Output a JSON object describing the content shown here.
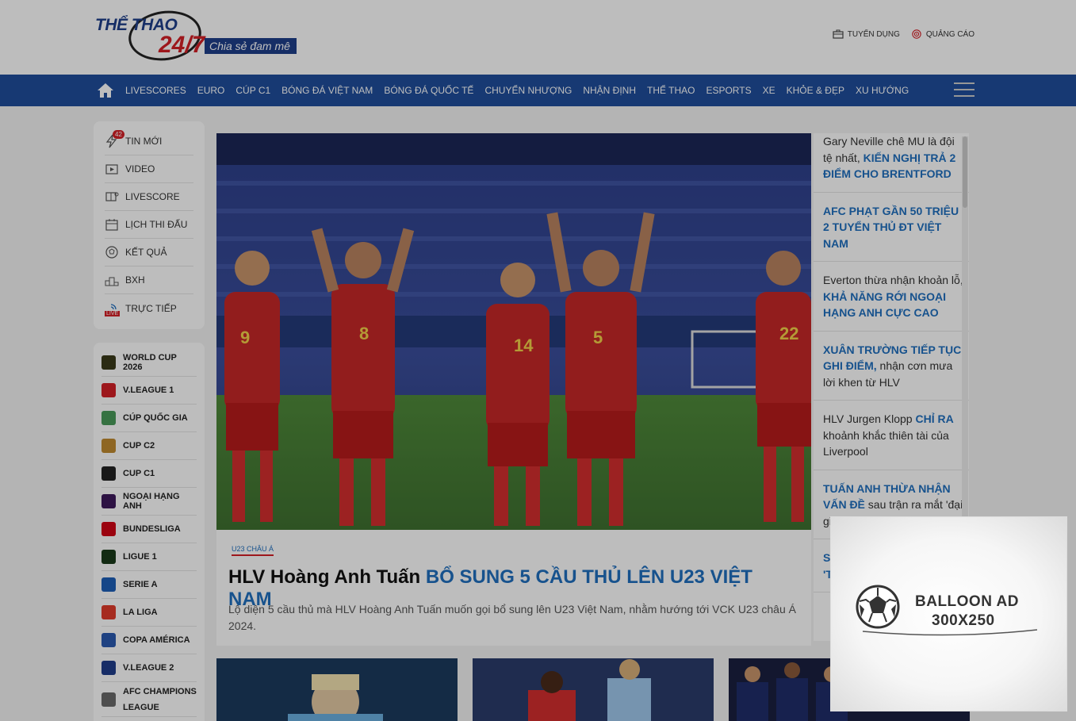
{
  "header": {
    "logo": {
      "the": "THỂ THAO",
      "num": "24/7",
      "slogan": "Chia sẻ đam mê"
    },
    "links": [
      {
        "label": "TUYỂN DỤNG",
        "icon": "briefcase-icon"
      },
      {
        "label": "QUẢNG CÁO",
        "icon": "target-icon"
      }
    ]
  },
  "nav": {
    "items": [
      "LIVESCORES",
      "EURO",
      "CÚP C1",
      "BÓNG ĐÁ VIỆT NAM",
      "BÓNG ĐÁ QUỐC TẾ",
      "CHUYỂN NHƯỢNG",
      "NHẬN ĐỊNH",
      "THỂ THAO",
      "ESPORTS",
      "XE",
      "KHỎE & ĐẸP",
      "XU HƯỚNG"
    ]
  },
  "sidebar": {
    "items": [
      {
        "label": "TIN MỚI",
        "badge": "42"
      },
      {
        "label": "VIDEO"
      },
      {
        "label": "LIVESCORE"
      },
      {
        "label": "LỊCH THI ĐẤU"
      },
      {
        "label": "KẾT QUẢ"
      },
      {
        "label": "BXH"
      },
      {
        "label": "TRỰC TIẾP",
        "badge": "LIVE"
      }
    ],
    "leagues": [
      {
        "label": "WORLD CUP 2026",
        "color": "#3a3a1a"
      },
      {
        "label": "V.LEAGUE 1",
        "color": "#d41f26"
      },
      {
        "label": "CÚP QUỐC GIA",
        "color": "#4a9a5a"
      },
      {
        "label": "CUP C2",
        "color": "#c08a30"
      },
      {
        "label": "CUP C1",
        "color": "#222222"
      },
      {
        "label": "NGOẠI HẠNG ANH",
        "color": "#3d195b"
      },
      {
        "label": "BUNDESLIGA",
        "color": "#d20515"
      },
      {
        "label": "LIGUE 1",
        "color": "#1a3a1a"
      },
      {
        "label": "SERIE A",
        "color": "#1d5fb8"
      },
      {
        "label": "LA LIGA",
        "color": "#e03a2a"
      },
      {
        "label": "COPA AMÉRICA",
        "color": "#2a5ab0"
      },
      {
        "label": "V.LEAGUE 2",
        "color": "#1f3d8c"
      },
      {
        "label": "AFC CHAMPIONS LEAGUE",
        "color": "#6a6a6a"
      }
    ]
  },
  "featured": {
    "category": "U23 CHÂU Á",
    "title_a": "HLV Hoàng Anh Tuấn ",
    "title_b": "BỔ SUNG 5 CẦU THỦ LÊN U23 VIỆT NAM",
    "sapo": "Lộ diện 5 cầu thủ mà HLV Hoàng Anh Tuấn muốn gọi bổ sung lên U23 Việt Nam, nhằm hướng tới VCK U23 châu Á 2024."
  },
  "news": [
    {
      "pre": "Gary Neville chê MU là đội tệ nhất, ",
      "hl": "KIẾN NGHỊ TRẢ 2 ĐIỂM CHO BRENTFORD",
      "post": ""
    },
    {
      "pre": "",
      "hl": "AFC PHẠT GẦN 50 TRIỆU 2 TUYỂN THỦ ĐT VIỆT NAM",
      "post": ""
    },
    {
      "pre": "Everton thừa nhận khoản lỗ, ",
      "hl": "KHẢ NĂNG RỚI NGOẠI HẠNG ANH CỰC CAO",
      "post": ""
    },
    {
      "pre": "",
      "hl": "XUÂN TRƯỜNG TIẾP TỤC GHI ĐIỂM,",
      "post": " nhận cơn mưa lời khen từ HLV"
    },
    {
      "pre": "HLV Jurgen Klopp ",
      "hl": "CHỈ RA",
      "post": " khoảnh khắc thiên tài của Liverpool"
    },
    {
      "pre": "",
      "hl": "TUẤN ANH THỪA NHẬN VẤN ĐỀ",
      "post": " sau trận ra mắt 'đại gia V-League'"
    },
    {
      "pre": "",
      "hl": "SALIBA KHIẾN HAALAND 'T",
      "post": ""
    }
  ],
  "ad": {
    "line1": "BALLOON AD",
    "line2": "300X250"
  }
}
